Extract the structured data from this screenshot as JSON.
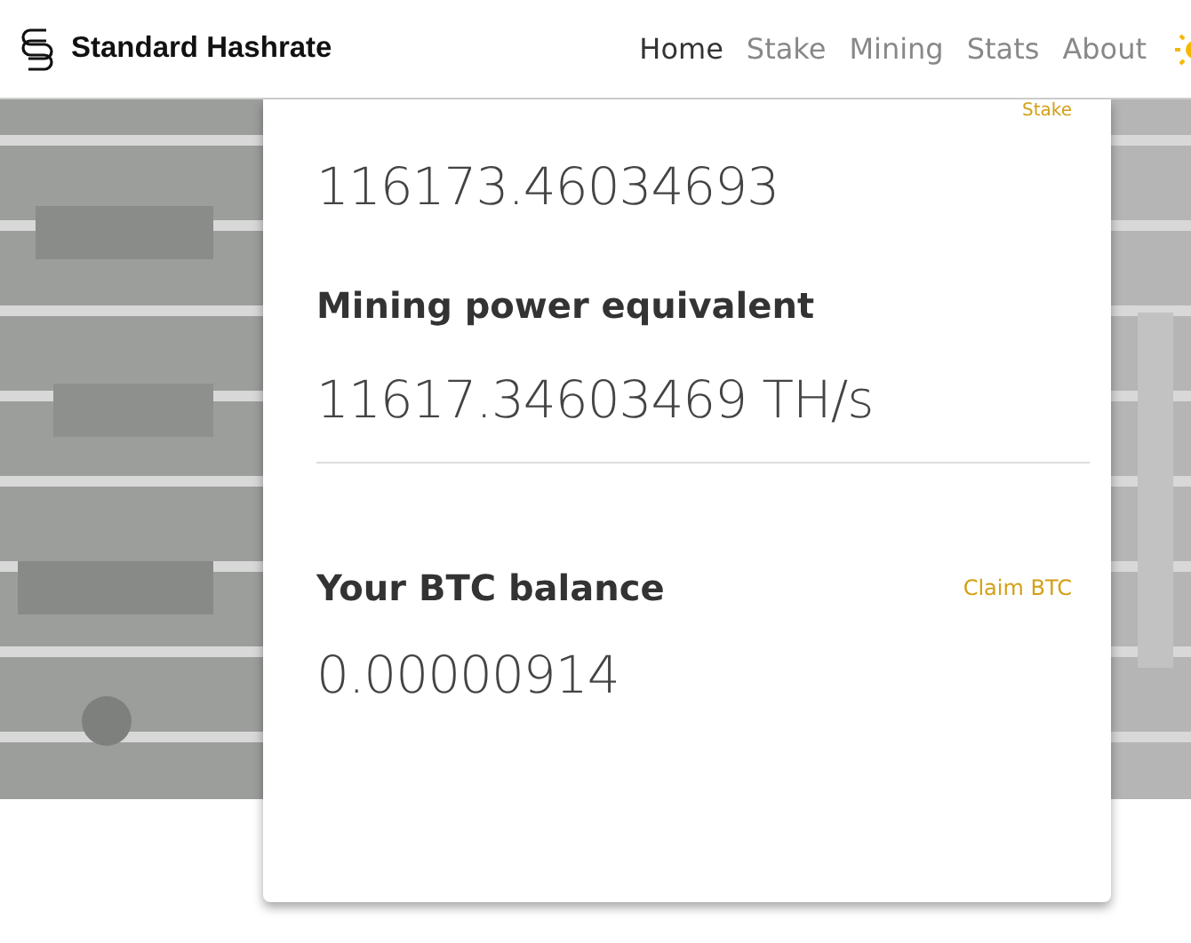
{
  "brand": {
    "name": "Standard Hashrate"
  },
  "nav": [
    {
      "label": "Home",
      "selected": true
    },
    {
      "label": "Stake",
      "selected": false
    },
    {
      "label": "Mining",
      "selected": false
    },
    {
      "label": "Stats",
      "selected": false
    },
    {
      "label": "About",
      "selected": false
    }
  ],
  "card": {
    "top_link": "Stake",
    "stake_value": "116173.46034693",
    "mining_title": "Mining power equivalent",
    "mining_value": "11617.34603469 TH/s",
    "btc_title": "Your BTC balance",
    "btc_link": "Claim BTC",
    "btc_value": "0.00000914"
  }
}
